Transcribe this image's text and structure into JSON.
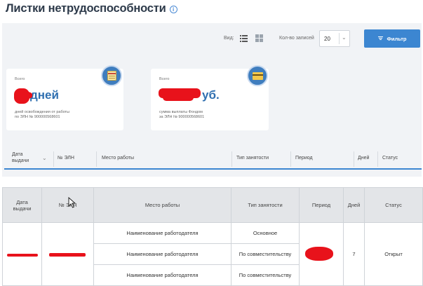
{
  "page": {
    "title": "Листки нетрудоспособности",
    "info_icon": "info-circle-icon"
  },
  "toolbar": {
    "view_label": "Вид:",
    "view_modes": [
      "list-view-icon",
      "grid-view-icon"
    ],
    "records_label": "Кол-во записей",
    "records_value": "20",
    "filter_label": "Фильтр",
    "colors": {
      "accent": "#3c86d1",
      "panel": "#f1f3f6"
    }
  },
  "cards": [
    {
      "caption": "Всего",
      "value": "дней",
      "value_redacted": true,
      "description_line1": "дней освобождения от работы",
      "description_line2": "по ЭЛН № 900000568601",
      "icon": "calendar-icon"
    },
    {
      "caption": "Всего",
      "value": "уб.",
      "value_redacted": true,
      "description_line1": "сумма выплаты Фондом",
      "description_line2": "за ЭЛН № 900000568601",
      "icon": "credit-card-icon"
    }
  ],
  "list_header": {
    "date_line1": "Дата",
    "date_line2": "выдачи",
    "eln": "№ ЭЛН",
    "workplace": "Место работы",
    "employment_type": "Тип занятости",
    "period": "Период",
    "days": "Дней",
    "status": "Статус"
  },
  "table": {
    "headers": {
      "date_line1": "Дата",
      "date_line2": "выдачи",
      "eln": "№ ЭЛН",
      "workplace": "Место работы",
      "employment_type": "Тип занятости",
      "period": "Период",
      "days": "Дней",
      "status": "Статус"
    },
    "record": {
      "issue_date": "",
      "eln_number": "",
      "period": "",
      "days": "7",
      "status": "Открыт",
      "workplaces": [
        {
          "name": "Наименование работодателя",
          "employment_type": "Основное"
        },
        {
          "name": "Наименование работодателя",
          "employment_type": "По совместительству"
        },
        {
          "name": "Наименование работодателя",
          "employment_type": "По совместительству"
        }
      ]
    }
  }
}
